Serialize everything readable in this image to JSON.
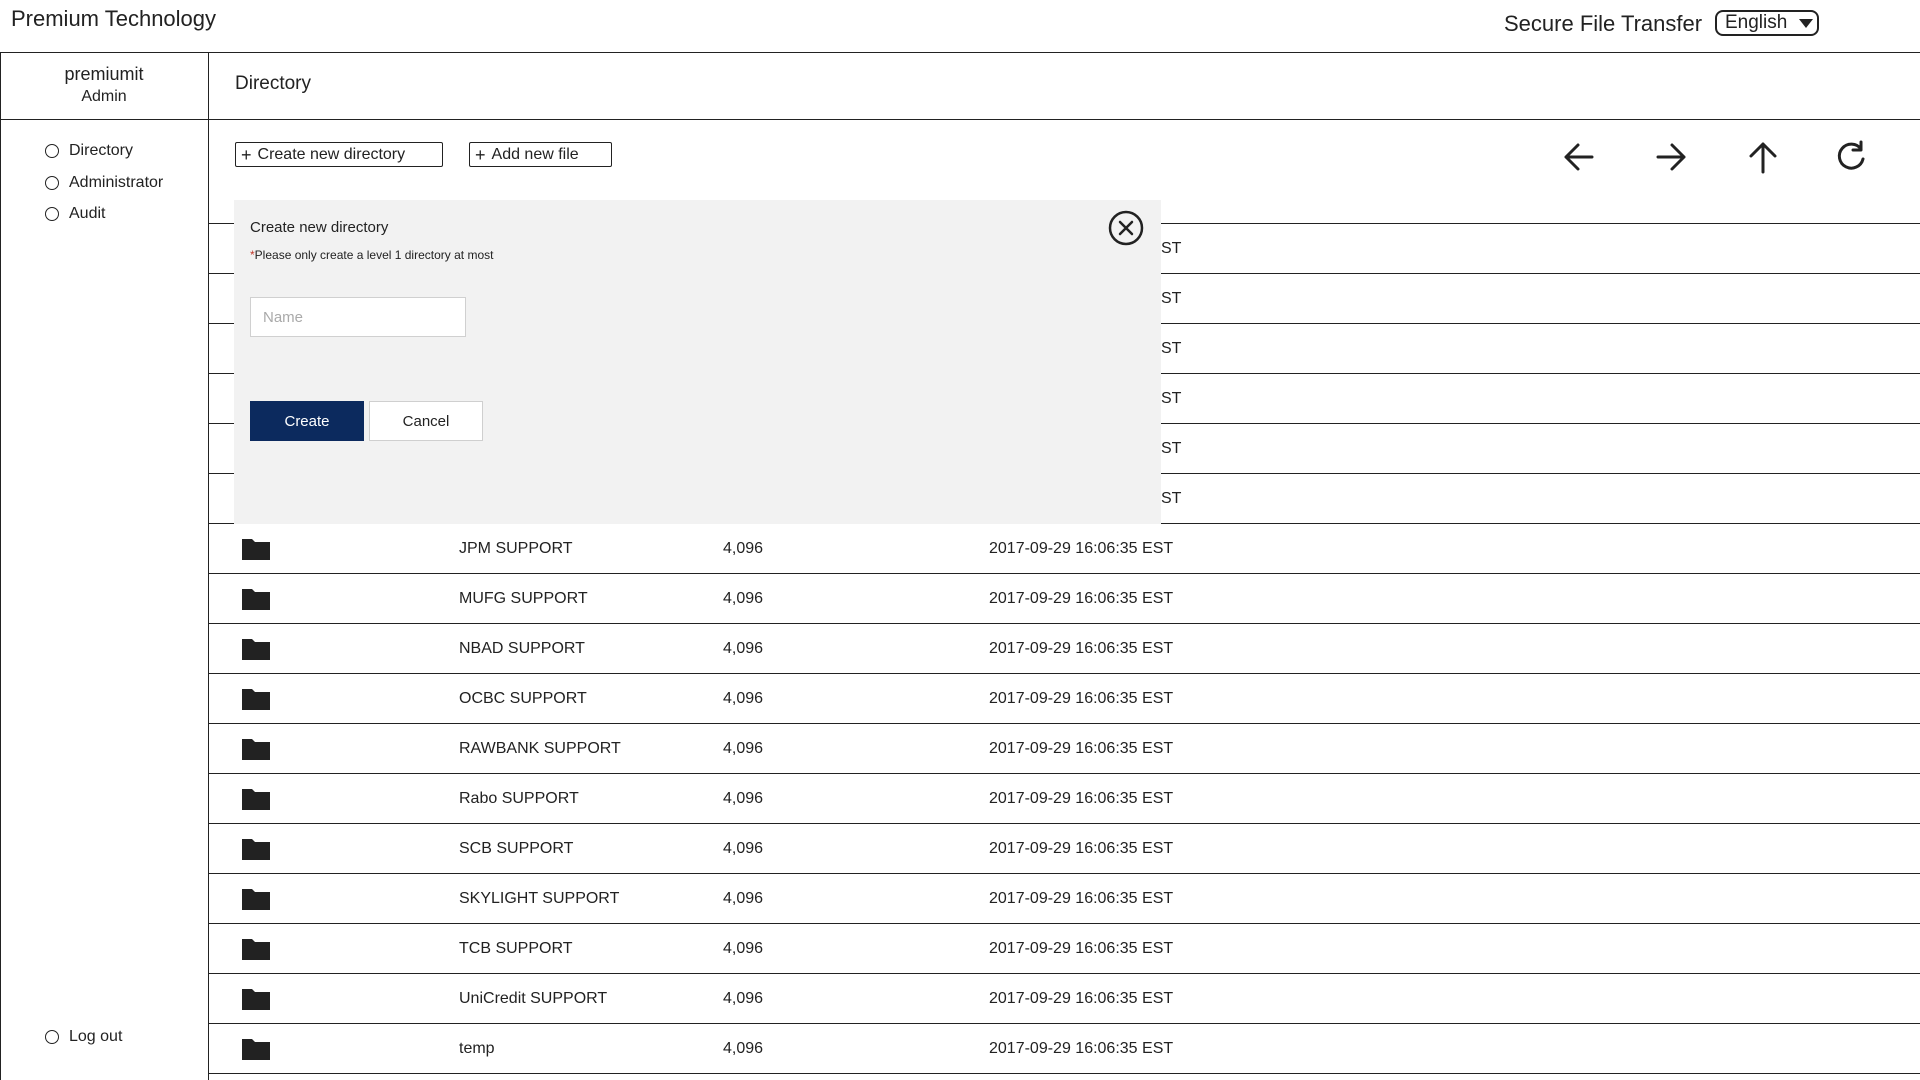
{
  "header": {
    "brand": "Premium Technology",
    "product": "Secure File Transfer",
    "language": "English"
  },
  "sidebar": {
    "username": "premiumit",
    "role": "Admin",
    "items": [
      {
        "label": "Directory"
      },
      {
        "label": "Administrator"
      },
      {
        "label": "Audit"
      }
    ],
    "logout": "Log out"
  },
  "main": {
    "title": "Directory",
    "create_dir_label": "Create new directory",
    "add_file_label": "Add new file",
    "nav_icons": [
      "arrow-left-icon",
      "arrow-right-icon",
      "arrow-up-icon",
      "refresh-icon"
    ],
    "partial_modified_suffix": "ST",
    "rows": [
      {
        "name": "JPM SUPPORT",
        "size": "4,096",
        "modified": "2017-09-29 16:06:35 EST"
      },
      {
        "name": "MUFG SUPPORT",
        "size": "4,096",
        "modified": "2017-09-29 16:06:35 EST"
      },
      {
        "name": "NBAD SUPPORT",
        "size": "4,096",
        "modified": "2017-09-29 16:06:35 EST"
      },
      {
        "name": "OCBC SUPPORT",
        "size": "4,096",
        "modified": "2017-09-29 16:06:35 EST"
      },
      {
        "name": "RAWBANK SUPPORT",
        "size": "4,096",
        "modified": "2017-09-29 16:06:35 EST"
      },
      {
        "name": "Rabo SUPPORT",
        "size": "4,096",
        "modified": "2017-09-29 16:06:35 EST"
      },
      {
        "name": "SCB SUPPORT",
        "size": "4,096",
        "modified": "2017-09-29 16:06:35 EST"
      },
      {
        "name": "SKYLIGHT SUPPORT",
        "size": "4,096",
        "modified": "2017-09-29 16:06:35 EST"
      },
      {
        "name": "TCB SUPPORT",
        "size": "4,096",
        "modified": "2017-09-29 16:06:35 EST"
      },
      {
        "name": "UniCredit SUPPORT",
        "size": "4,096",
        "modified": "2017-09-29 16:06:35 EST"
      },
      {
        "name": "temp",
        "size": "4,096",
        "modified": "2017-09-29 16:06:35 EST"
      }
    ]
  },
  "modal": {
    "title": "Create new directory",
    "note_star": "*",
    "note": "Please only create a level 1 directory at most",
    "name_placeholder": "Name",
    "name_value": "",
    "create_label": "Create",
    "cancel_label": "Cancel"
  },
  "colors": {
    "primary_button": "#0c2a5e",
    "modal_background": "#f2f2f2",
    "line": "#222222"
  }
}
